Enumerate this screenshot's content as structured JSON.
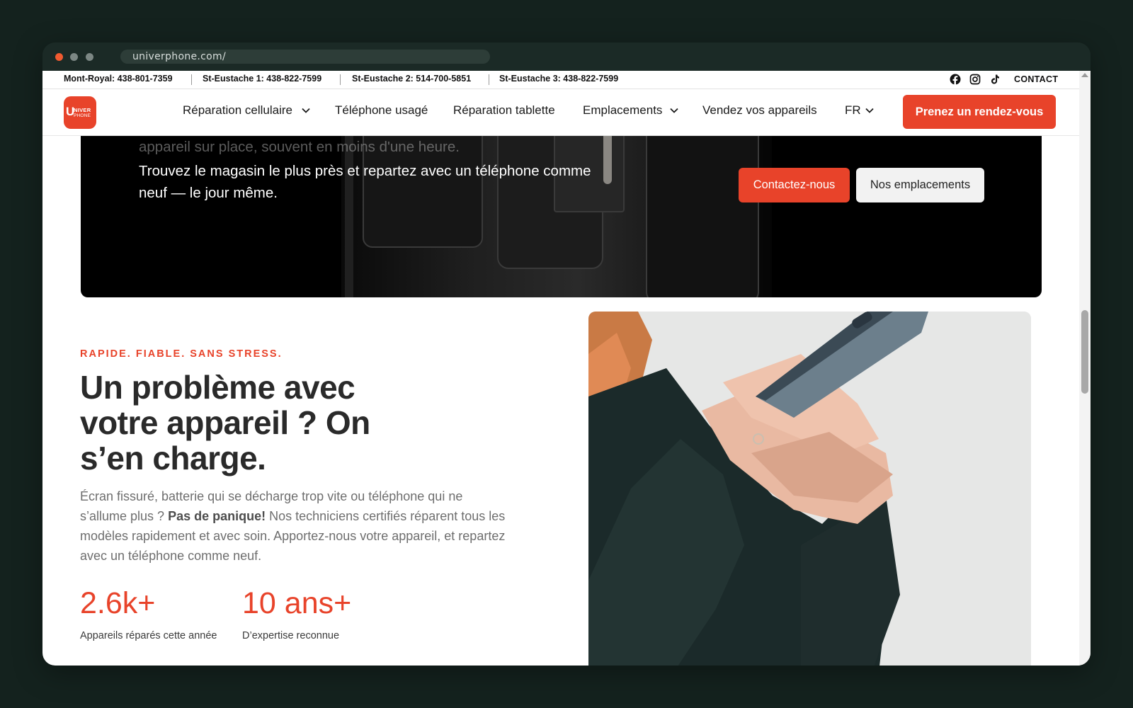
{
  "browser": {
    "url": "univerphone.com/"
  },
  "topbar": {
    "phones": [
      "Mont-Royal: 438-801-7359",
      "St-Eustache 1: 438-822-7599",
      "St-Eustache 2: 514-700-5851",
      "St-Eustache 3: 438-822-7599"
    ],
    "social_icons": [
      "facebook-icon",
      "instagram-icon",
      "tiktok-icon"
    ],
    "contact_label": "CONTACT"
  },
  "nav": {
    "logo_text": {
      "letter": "U",
      "line1": "NIVER",
      "line2": "PHONE"
    },
    "items": [
      {
        "label": "Réparation cellulaire",
        "dropdown": true
      },
      {
        "label": "Téléphone usagé",
        "dropdown": false
      },
      {
        "label": "Réparation tablette",
        "dropdown": false
      },
      {
        "label": "Emplacements",
        "dropdown": true
      },
      {
        "label": "Vendez vos appareils",
        "dropdown": false
      },
      {
        "label": "FR",
        "dropdown": true
      }
    ],
    "cta_label": "Prenez un rendez-vous"
  },
  "hero": {
    "faded_text": "appareil sur place, souvent en moins d'une heure.",
    "text": "Trouvez le magasin le plus près et repartez avec un téléphone comme neuf — le jour même.",
    "contact_button": "Contactez-nous",
    "locations_button": "Nos emplacements"
  },
  "main": {
    "eyebrow": "RAPIDE. FIABLE. SANS STRESS.",
    "heading": "Un problème avec votre appareil ? On s’en charge.",
    "paragraph_part1": "Écran fissuré, batterie qui se décharge trop vite ou téléphone qui ne s’allume plus ? ",
    "paragraph_bold": "Pas de panique!",
    "paragraph_part2": " Nos techniciens certifiés réparent tous les modèles rapidement et avec soin. Apportez-nous votre appareil, et repartez avec un téléphone comme neuf.",
    "stats": [
      {
        "value": "2.6k+",
        "label": "Appareils réparés cette année"
      },
      {
        "value": "10 ans+",
        "label": "D’expertise reconnue"
      }
    ]
  },
  "colors": {
    "accent": "#e8432a",
    "window_bg": "#1b2a26",
    "page_bg": "#14221e"
  }
}
